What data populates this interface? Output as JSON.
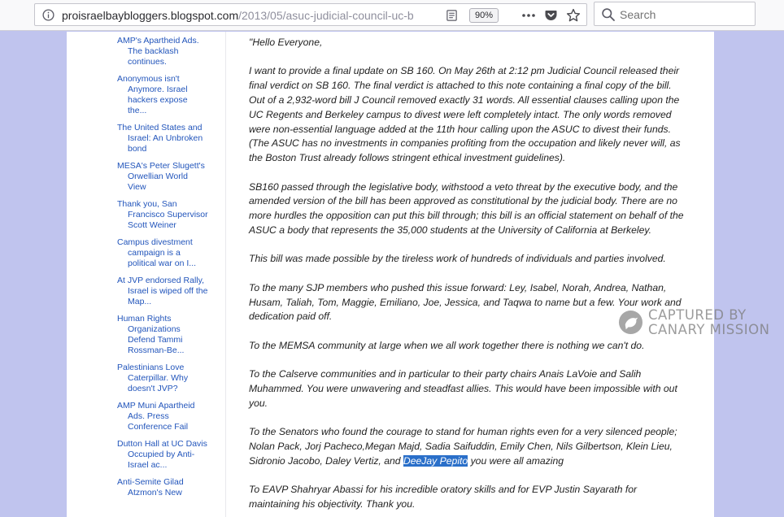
{
  "browser": {
    "url_host": "proisraelbaybloggers.blogspot.com",
    "url_path": "/2013/05/asuc-judicial-council-uc-b",
    "zoom": "90%",
    "search_placeholder": "Search"
  },
  "sidebar": {
    "links": [
      "AMP's Apartheid Ads. The backlash continues.",
      "Anonymous isn't Anymore. Israel hackers expose the...",
      "The United States and Israel: An Unbroken bond",
      "MESA's Peter Slugett's Orwellian World View",
      "Thank you, San Francisco Supervisor Scott Weiner",
      "Campus divestment campaign is a political war on I...",
      "At JVP endorsed Rally, Israel is wiped off the Map...",
      "Human Rights Organizations Defend Tammi Rossman-Be...",
      "Palestinians Love Caterpillar. Why doesn't JVP?",
      "AMP Muni Apartheid Ads. Press Conference Fail",
      "Dutton Hall at UC Davis Occupied by Anti-Israel ac...",
      "Anti-Semite Gilad Atzmon's New"
    ]
  },
  "post": {
    "p1": "\"Hello Everyone,",
    "p2": "I want to provide a final update on SB 160. On May 26th at 2:12 pm Judicial Council released their final verdict on SB 160. The final verdict is attached to this note containing a final copy of the bill. Out of a 2,932-word bill J Council removed exactly 31 words. All essential clauses calling upon the UC Regents and Berkeley campus to divest were left completely intact. The only words removed were non-essential language added at the 11th hour calling upon the ASUC to divest their funds. (The ASUC has no investments in companies profiting from the occupation and likely never will, as the Boston Trust already follows stringent  ethical investment guidelines).",
    "p3": "SB160 passed through the legislative body, withstood a veto threat by the executive body, and the amended version of the bill has been approved as constitutional by the judicial body. There are no more hurdles the opposition can put this bill through; this bill is an official statement on behalf of the ASUC a body that represents the 35,000 students at the University of California at Berkeley.",
    "p4": "This bill was made possible by the tireless work of hundreds of individuals and parties involved.",
    "p5": "To the many SJP members who pushed this issue forward: Ley, Isabel, Norah, Andrea, Nathan, Husam, Taliah, Tom, Maggie, Emiliano, Joe, Jessica, and Taqwa to name but a few. Your work and dedication paid off.",
    "p6": "To the MEMSA community at large when we all work together there is nothing we can't do.",
    "p7": "To the Calserve communities and in particular to their party chairs Anais LaVoie and Salih Muhammed. You were unwavering and steadfast allies. This would have been impossible with out you.",
    "p8_before": "To the Senators who found the courage to stand for human rights even for a very silenced people; Nolan Pack, Jorj Pacheco,Megan Majd, Sadia Saifuddin, Emily Chen, Nils Gilbertson, Klein Lieu, Sidronio Jacobo, Daley Vertiz, and ",
    "p8_highlight": "DeeJay Pepito",
    "p8_after": " you were all amazing",
    "p9": "To EAVP Shahryar Abassi for his incredible oratory skills and for EVP Justin Sayarath for maintaining his objectivity. Thank you."
  },
  "watermark": {
    "line1": "CAPTURED BY",
    "line2": "CANARY MISSION"
  }
}
